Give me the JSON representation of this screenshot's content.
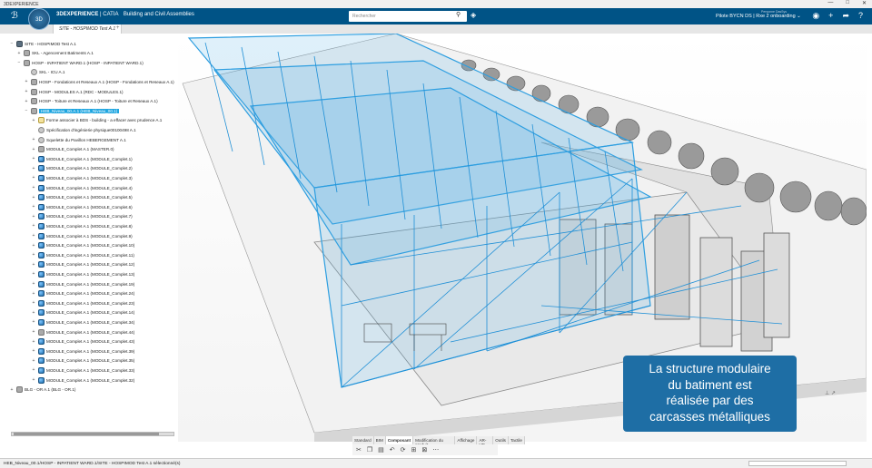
{
  "window": {
    "title": "3DEXPERIENCE",
    "controls": [
      "—",
      "□",
      "✕"
    ]
  },
  "header": {
    "brand_bold": "3DEXPERIENCE",
    "brand_app": " | CATIA",
    "brand_role": "Building and Civil Assemblies",
    "search_placeholder": "Rechercher",
    "user_line": "Pilote BYCN DS | Rxe 2 onboarding",
    "user_sub": "Personne DasSys"
  },
  "compass_label": "3D",
  "tab": {
    "label": "SITE - HOSPIMOD Test A.1",
    "plus": "+"
  },
  "tree": [
    {
      "label": "SITE - HOSPIMOD Test A.1",
      "depth": 0,
      "toggle": "−",
      "icon": "root"
    },
    {
      "label": "SKL - Agencement Batiments A.1",
      "depth": 1,
      "toggle": "+",
      "icon": "part"
    },
    {
      "label": "HOSP - INPATIENT WARD.1 (HOSP - INPATIENT WARD.1)",
      "depth": 1,
      "toggle": "−",
      "icon": "part"
    },
    {
      "label": "SKL - ICU A.1",
      "depth": 2,
      "toggle": "",
      "icon": "shape"
    },
    {
      "label": "HOSP - Fondations et Reseaux A.1 (HOSP - Fondations et Reseaux A.1)",
      "depth": 2,
      "toggle": "+",
      "icon": "part"
    },
    {
      "label": "HOSP - MODULES A.1 (RDC - MODULES.1)",
      "depth": 2,
      "toggle": "+",
      "icon": "part"
    },
    {
      "label": "HOSP - Toiture et Reseaux A.1 (HOSP - Toiture et Reseaux A.1)",
      "depth": 2,
      "toggle": "+",
      "icon": "part"
    },
    {
      "label": "HEB_Niveau_00.A.1 (HEB_Niveau_00.1)",
      "depth": 2,
      "toggle": "−",
      "icon": "part",
      "selected": true
    },
    {
      "label": "Forme associer à BDS - building -   a effacer avec prudence A.1",
      "depth": 3,
      "toggle": "+",
      "icon": "doc"
    },
    {
      "label": "Spécification d'ingénierie physique00100498 A.1",
      "depth": 3,
      "toggle": "",
      "icon": "shape"
    },
    {
      "label": "Squelette du Pavillon HEBERGEMENT A.1",
      "depth": 3,
      "toggle": "+",
      "icon": "shape"
    },
    {
      "label": "MODULE_Complet A.1 (MASTER.0)",
      "depth": 3,
      "toggle": "+",
      "icon": "part"
    },
    {
      "label": "MODULE_Complet A.1 (MODULE_Complet.1)",
      "depth": 3,
      "toggle": "+",
      "icon": "mod"
    },
    {
      "label": "MODULE_Complet A.1 (MODULE_Complet.2)",
      "depth": 3,
      "toggle": "+",
      "icon": "mod"
    },
    {
      "label": "MODULE_Complet A.1 (MODULE_Complet.3)",
      "depth": 3,
      "toggle": "+",
      "icon": "mod"
    },
    {
      "label": "MODULE_Complet A.1 (MODULE_Complet.4)",
      "depth": 3,
      "toggle": "+",
      "icon": "mod"
    },
    {
      "label": "MODULE_Complet A.1 (MODULE_Complet.5)",
      "depth": 3,
      "toggle": "+",
      "icon": "mod"
    },
    {
      "label": "MODULE_Complet A.1 (MODULE_Complet.6)",
      "depth": 3,
      "toggle": "+",
      "icon": "mod"
    },
    {
      "label": "MODULE_Complet A.1 (MODULE_Complet.7)",
      "depth": 3,
      "toggle": "+",
      "icon": "mod"
    },
    {
      "label": "MODULE_Complet A.1 (MODULE_Complet.8)",
      "depth": 3,
      "toggle": "+",
      "icon": "mod"
    },
    {
      "label": "MODULE_Complet A.1 (MODULE_Complet.9)",
      "depth": 3,
      "toggle": "+",
      "icon": "mod"
    },
    {
      "label": "MODULE_Complet A.1 (MODULE_Complet.10)",
      "depth": 3,
      "toggle": "+",
      "icon": "mod"
    },
    {
      "label": "MODULE_Complet A.1 (MODULE_Complet.11)",
      "depth": 3,
      "toggle": "+",
      "icon": "mod"
    },
    {
      "label": "MODULE_Complet A.1 (MODULE_Complet.12)",
      "depth": 3,
      "toggle": "+",
      "icon": "mod"
    },
    {
      "label": "MODULE_Complet A.1 (MODULE_Complet.13)",
      "depth": 3,
      "toggle": "+",
      "icon": "mod"
    },
    {
      "label": "MODULE_Complet A.1 (MODULE_Complet.19)",
      "depth": 3,
      "toggle": "+",
      "icon": "mod"
    },
    {
      "label": "MODULE_Complet A.1 (MODULE_Complet.24)",
      "depth": 3,
      "toggle": "+",
      "icon": "mod"
    },
    {
      "label": "MODULE_Complet A.1 (MODULE_Complet.23)",
      "depth": 3,
      "toggle": "+",
      "icon": "mod"
    },
    {
      "label": "MODULE_Complet A.1 (MODULE_Complet.14)",
      "depth": 3,
      "toggle": "+",
      "icon": "mod"
    },
    {
      "label": "MODULE_Complet A.1 (MODULE_Complet.34)",
      "depth": 3,
      "toggle": "+",
      "icon": "mod"
    },
    {
      "label": "MODULE_Complet A.1 (MODULE_Complet.44)",
      "depth": 3,
      "toggle": "+",
      "icon": "part"
    },
    {
      "label": "MODULE_Complet A.1 (MODULE_Complet.43)",
      "depth": 3,
      "toggle": "+",
      "icon": "mod"
    },
    {
      "label": "MODULE_Complet A.1 (MODULE_Complet.39)",
      "depth": 3,
      "toggle": "+",
      "icon": "mod"
    },
    {
      "label": "MODULE_Complet A.1 (MODULE_Complet.35)",
      "depth": 3,
      "toggle": "+",
      "icon": "mod"
    },
    {
      "label": "MODULE_Complet A.1 (MODULE_Complet.33)",
      "depth": 3,
      "toggle": "+",
      "icon": "mod"
    },
    {
      "label": "MODULE_Complet A.1 (MODULE_Complet.32)",
      "depth": 3,
      "toggle": "+",
      "icon": "mod"
    },
    {
      "label": "BLG - OR A.1 (BLG - OR.1)",
      "depth": 0,
      "toggle": "+",
      "icon": "part"
    }
  ],
  "caption": {
    "line1": "La structure modulaire",
    "line2": "du batiment est",
    "line3": "réalisée par des",
    "line4": "carcasses métalliques"
  },
  "action_bar": {
    "tabs": [
      "Standard",
      "BIM",
      "Composant",
      "Modification du produit",
      "Affichage",
      "AR-VR",
      "Outils",
      "Tactile"
    ],
    "active_index": 2
  },
  "status": {
    "text": "HEB_Niveau_00.1/HOSP - INPATIENT WARD.1/SITE - HOSPIMOD Test A.1 sélectionné(s)"
  },
  "colors": {
    "brand": "#005386",
    "accent": "#20a6e0",
    "caption_bg": "#1e6ea5"
  }
}
